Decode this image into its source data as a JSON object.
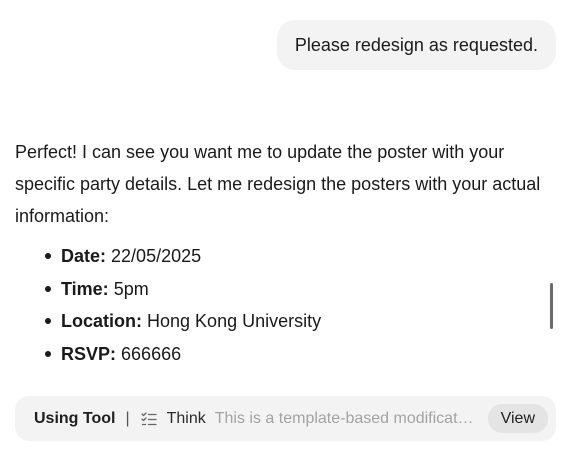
{
  "user_message": {
    "text": "Please redesign as requested."
  },
  "assistant_message": {
    "paragraph": "Perfect! I can see you want me to update the poster with your specific party details. Let me redesign the posters with your actual information:",
    "details": [
      {
        "label": "Date:",
        "value": "22/05/2025"
      },
      {
        "label": "Time:",
        "value": "5pm"
      },
      {
        "label": "Location:",
        "value": "Hong Kong University"
      },
      {
        "label": "RSVP:",
        "value": "666666"
      }
    ]
  },
  "tool_bar": {
    "status": "Using Tool",
    "separator": "|",
    "icon": "checklist-icon",
    "tool_name": "Think",
    "description": "This is a template-based modificati…",
    "view_label": "View"
  }
}
